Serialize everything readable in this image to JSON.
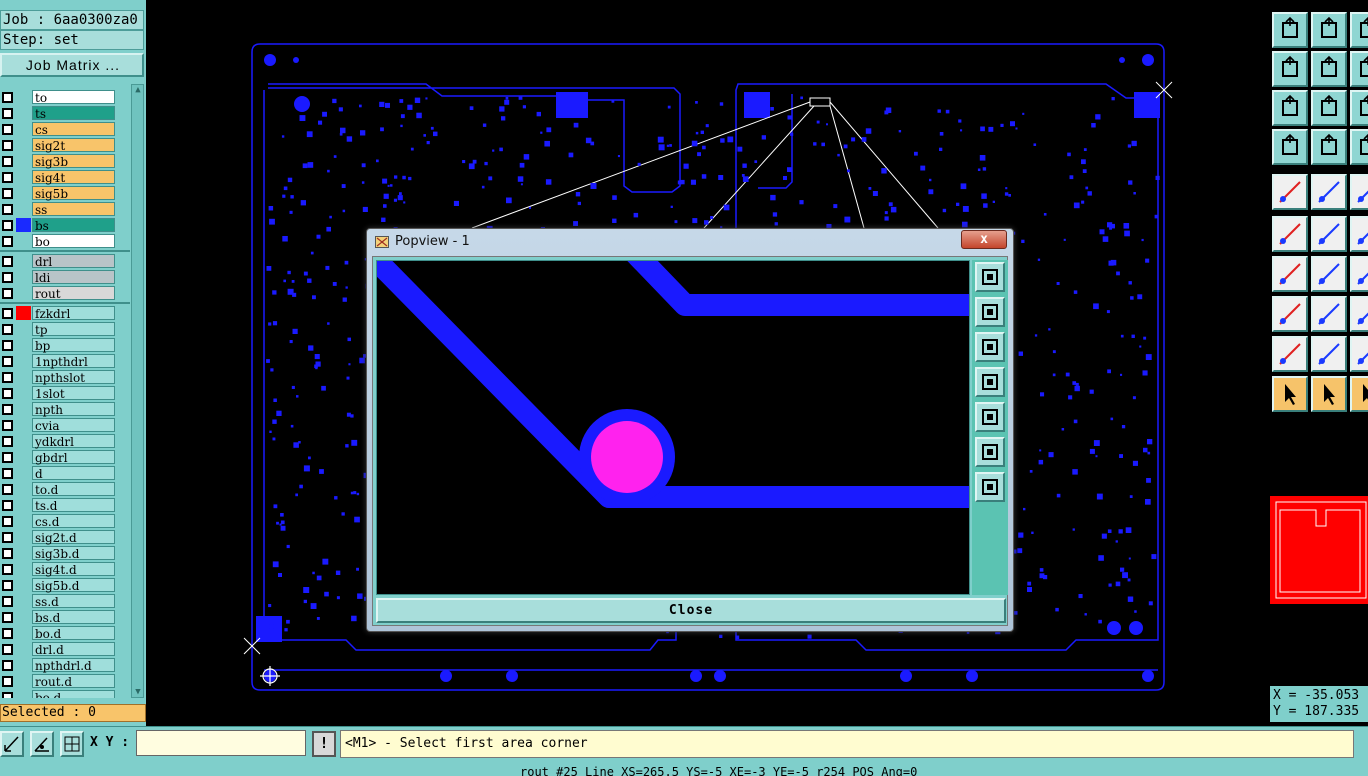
{
  "job_label": "Job : 6aa0300za0",
  "step_label": "Step: set",
  "job_matrix_label": "Job Matrix ...",
  "layers": [
    {
      "name": "to",
      "color": "#ffffff",
      "marker": ""
    },
    {
      "name": "ts",
      "color": "#1fa08a",
      "marker": ""
    },
    {
      "name": "cs",
      "color": "#f8c46a",
      "marker": ""
    },
    {
      "name": "sig2t",
      "color": "#f8c46a",
      "marker": ""
    },
    {
      "name": "sig3b",
      "color": "#f8c46a",
      "marker": ""
    },
    {
      "name": "sig4t",
      "color": "#f8c46a",
      "marker": ""
    },
    {
      "name": "sig5b",
      "color": "#f8c46a",
      "marker": ""
    },
    {
      "name": "ss",
      "color": "#f8c46a",
      "marker": ""
    },
    {
      "name": "bs",
      "color": "#1fa08a",
      "marker": "#1a2aff"
    },
    {
      "name": "bo",
      "color": "#ffffff",
      "marker": ""
    },
    {
      "name": "drl",
      "color": "#b8c4c8",
      "marker": ""
    },
    {
      "name": "ldi",
      "color": "#b8c4c8",
      "marker": ""
    },
    {
      "name": "rout",
      "color": "#d8d8d8",
      "marker": ""
    },
    {
      "name": "fzkdrl",
      "color": "#9fdedb",
      "marker": "#ff0000"
    },
    {
      "name": "tp",
      "color": "#9fdedb",
      "marker": ""
    },
    {
      "name": "bp",
      "color": "#9fdedb",
      "marker": ""
    },
    {
      "name": "1npthdrl",
      "color": "#9fdedb",
      "marker": ""
    },
    {
      "name": "npthslot",
      "color": "#9fdedb",
      "marker": ""
    },
    {
      "name": "1slot",
      "color": "#9fdedb",
      "marker": ""
    },
    {
      "name": "npth",
      "color": "#9fdedb",
      "marker": ""
    },
    {
      "name": "cvia",
      "color": "#9fdedb",
      "marker": ""
    },
    {
      "name": "ydkdrl",
      "color": "#9fdedb",
      "marker": ""
    },
    {
      "name": "gbdrl",
      "color": "#9fdedb",
      "marker": ""
    },
    {
      "name": "d",
      "color": "#9fdedb",
      "marker": ""
    },
    {
      "name": "to.d",
      "color": "#9fdedb",
      "marker": ""
    },
    {
      "name": "ts.d",
      "color": "#9fdedb",
      "marker": ""
    },
    {
      "name": "cs.d",
      "color": "#9fdedb",
      "marker": ""
    },
    {
      "name": "sig2t.d",
      "color": "#9fdedb",
      "marker": ""
    },
    {
      "name": "sig3b.d",
      "color": "#9fdedb",
      "marker": ""
    },
    {
      "name": "sig4t.d",
      "color": "#9fdedb",
      "marker": ""
    },
    {
      "name": "sig5b.d",
      "color": "#9fdedb",
      "marker": ""
    },
    {
      "name": "ss.d",
      "color": "#9fdedb",
      "marker": ""
    },
    {
      "name": "bs.d",
      "color": "#9fdedb",
      "marker": ""
    },
    {
      "name": "bo.d",
      "color": "#9fdedb",
      "marker": ""
    },
    {
      "name": "drl.d",
      "color": "#9fdedb",
      "marker": ""
    },
    {
      "name": "npthdrl.d",
      "color": "#9fdedb",
      "marker": ""
    },
    {
      "name": "rout.d",
      "color": "#9fdedb",
      "marker": ""
    },
    {
      "name": "bo.d",
      "color": "#9fdedb",
      "marker": ""
    }
  ],
  "selected_label": "Selected : 0",
  "popview": {
    "title": "Popview - 1",
    "close_x": "x",
    "close_button": "Close"
  },
  "coords": {
    "x": "X = -35.053",
    "y": "Y = 187.335"
  },
  "bottom": {
    "xy_label": "X Y :",
    "xy_value": "",
    "warn": "!",
    "message": "<M1> - Select first area corner",
    "status": "rout #25 Line XS=265.5 YS=-5 XE=-3 YE=-5 r254 POS Ang=0"
  },
  "colors": {
    "copper": "#1a1aff",
    "pad_highlight": "#ff22ee",
    "ui_teal": "#7fcfcb",
    "accent_red": "#ff0000"
  },
  "right_tools": [
    "step-up-icon",
    "step-down-icon",
    "step-left-placeholder",
    "pan-left-icon",
    "pan-right-icon",
    "rotate-icon",
    "zoom-fit-icon",
    "zoom-home-icon",
    "info-icon",
    "measure-icon",
    "snap-icon",
    "route-icon",
    "fill-icon",
    "knife-icon",
    "grid-icon",
    "net-icon",
    "cross-icon",
    "circle-icon",
    "draw-line-red-icon",
    "draw-line-blue-icon",
    "draw-line-alt-icon",
    "pad-icon",
    "line-edit-icon",
    "line-extend-icon",
    "triangle-icon",
    "triangle-alt-icon",
    "triangle-third-icon",
    "select-arrow-icon",
    "select-arrow-frame-icon",
    "select-lasso-icon"
  ],
  "popview_tools": [
    "zoom-window-icon",
    "pan-up-icon",
    "pan-down-icon",
    "pan-left-icon",
    "pan-right-icon",
    "zoom-fit-icon",
    "zoom-home-icon"
  ]
}
